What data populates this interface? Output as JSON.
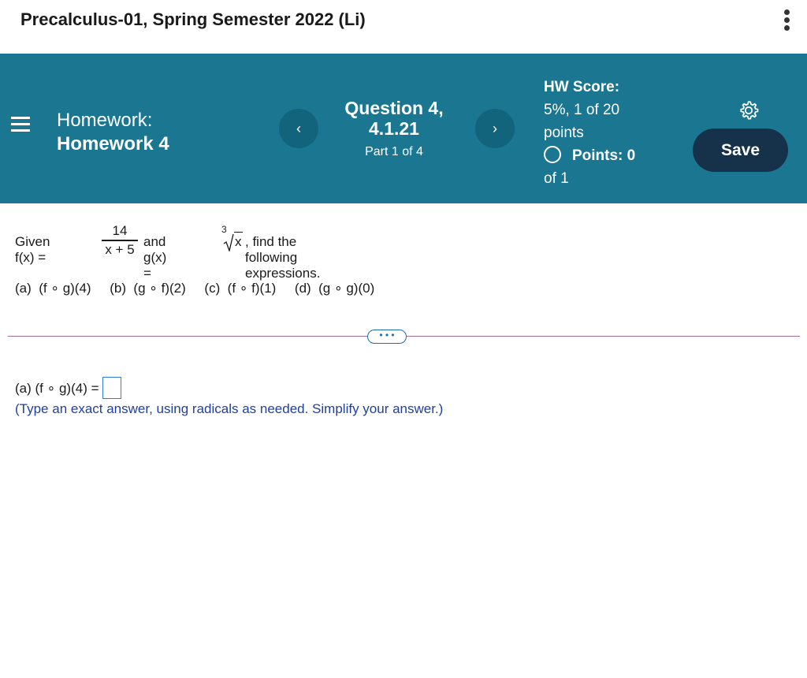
{
  "course_title": "Precalculus-01, Spring Semester 2022 (Li)",
  "header": {
    "homework_label": "Homework:",
    "homework_name": "Homework 4",
    "question_title": "Question 4,",
    "question_number": "4.1.21",
    "part": "Part 1 of 4",
    "prev_label": "‹",
    "next_label": "›",
    "hw_score_label": "HW Score:",
    "hw_score_value": "5%, 1 of 20",
    "hw_score_unit": "points",
    "points_label": "Points: 0",
    "points_of": "of 1",
    "save_label": "Save"
  },
  "question": {
    "given": "Given f(x) =",
    "frac_num": "14",
    "frac_den": "x + 5",
    "and_g": "and g(x) =",
    "root_index": "3",
    "root_radicand": "x",
    "rest": ", find the following expressions.",
    "parts": "(a)  (f ∘ g)(4)     (b)  (g ∘ f)(2)     (c)  (f ∘ f)(1)     (d)  (g ∘ g)(0)"
  },
  "more_label": "• • •",
  "answer": {
    "prompt": "(a) (f ∘ g)(4) =",
    "value": "",
    "hint": "(Type an exact answer, using radicals as needed.  Simplify your answer.)"
  },
  "colors": {
    "header_bg": "#1a7691",
    "save_bg": "#16324a",
    "hint": "#1f3fa0"
  }
}
